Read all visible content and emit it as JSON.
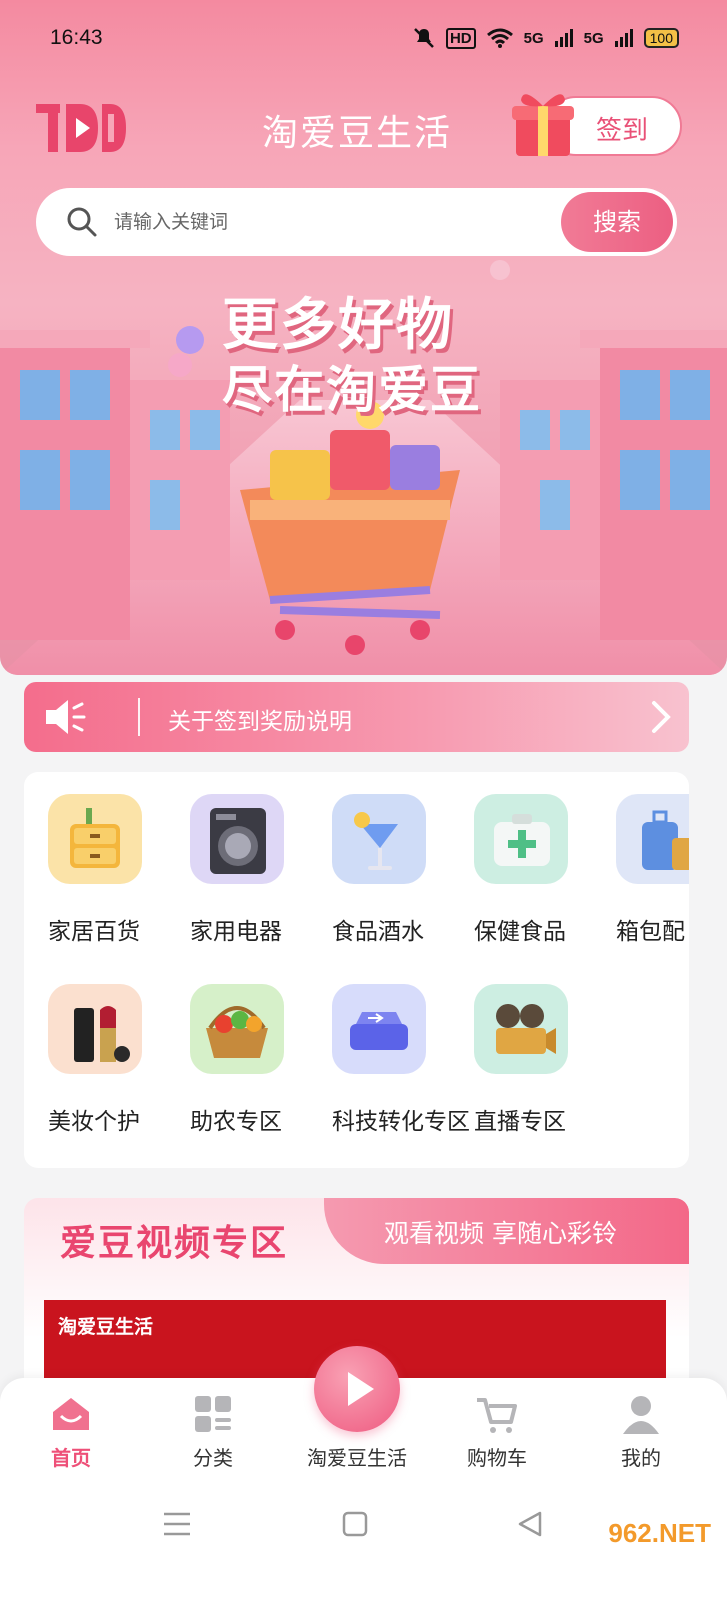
{
  "status_bar": {
    "time": "16:43",
    "hd": "HD",
    "net1": "5G",
    "net2": "5G",
    "battery": "100"
  },
  "header": {
    "logo": "TAD",
    "title": "淘爱豆生活",
    "signin_label": "签到"
  },
  "search": {
    "placeholder": "请输入关键词",
    "button_label": "搜索"
  },
  "banner": {
    "line1": "更多好物",
    "line2": "尽在淘爱豆"
  },
  "notice": {
    "text": "关于签到奖励说明"
  },
  "categories": [
    {
      "label": "家居百货",
      "icon": "cabinet-icon"
    },
    {
      "label": "家用电器",
      "icon": "washing-machine-icon"
    },
    {
      "label": "食品酒水",
      "icon": "drink-icon"
    },
    {
      "label": "保健食品",
      "icon": "first-aid-icon"
    },
    {
      "label": "箱包配",
      "icon": "luggage-icon"
    },
    {
      "label": "美妆个护",
      "icon": "lipstick-icon"
    },
    {
      "label": "助农专区",
      "icon": "vegetable-basket-icon"
    },
    {
      "label": "科技转化专区",
      "icon": "tech-device-icon"
    },
    {
      "label": "直播专区",
      "icon": "camera-icon"
    }
  ],
  "video_zone": {
    "title": "爱豆视频专区",
    "subtitle": "观看视频 享随心彩铃",
    "card_brand": "淘爱豆生活"
  },
  "bottom_nav": [
    {
      "label": "首页",
      "icon": "home-icon",
      "active": true
    },
    {
      "label": "分类",
      "icon": "grid-icon",
      "active": false
    },
    {
      "label": "淘爱豆生活",
      "icon": "play-icon",
      "active": false
    },
    {
      "label": "购物车",
      "icon": "cart-icon",
      "active": false
    },
    {
      "label": "我的",
      "icon": "user-icon",
      "active": false
    }
  ],
  "watermark": "962.NET",
  "colors": {
    "accent": "#ee5078",
    "hero_pink": "#f7a6b8",
    "notice_pink": "#f46d8c"
  }
}
